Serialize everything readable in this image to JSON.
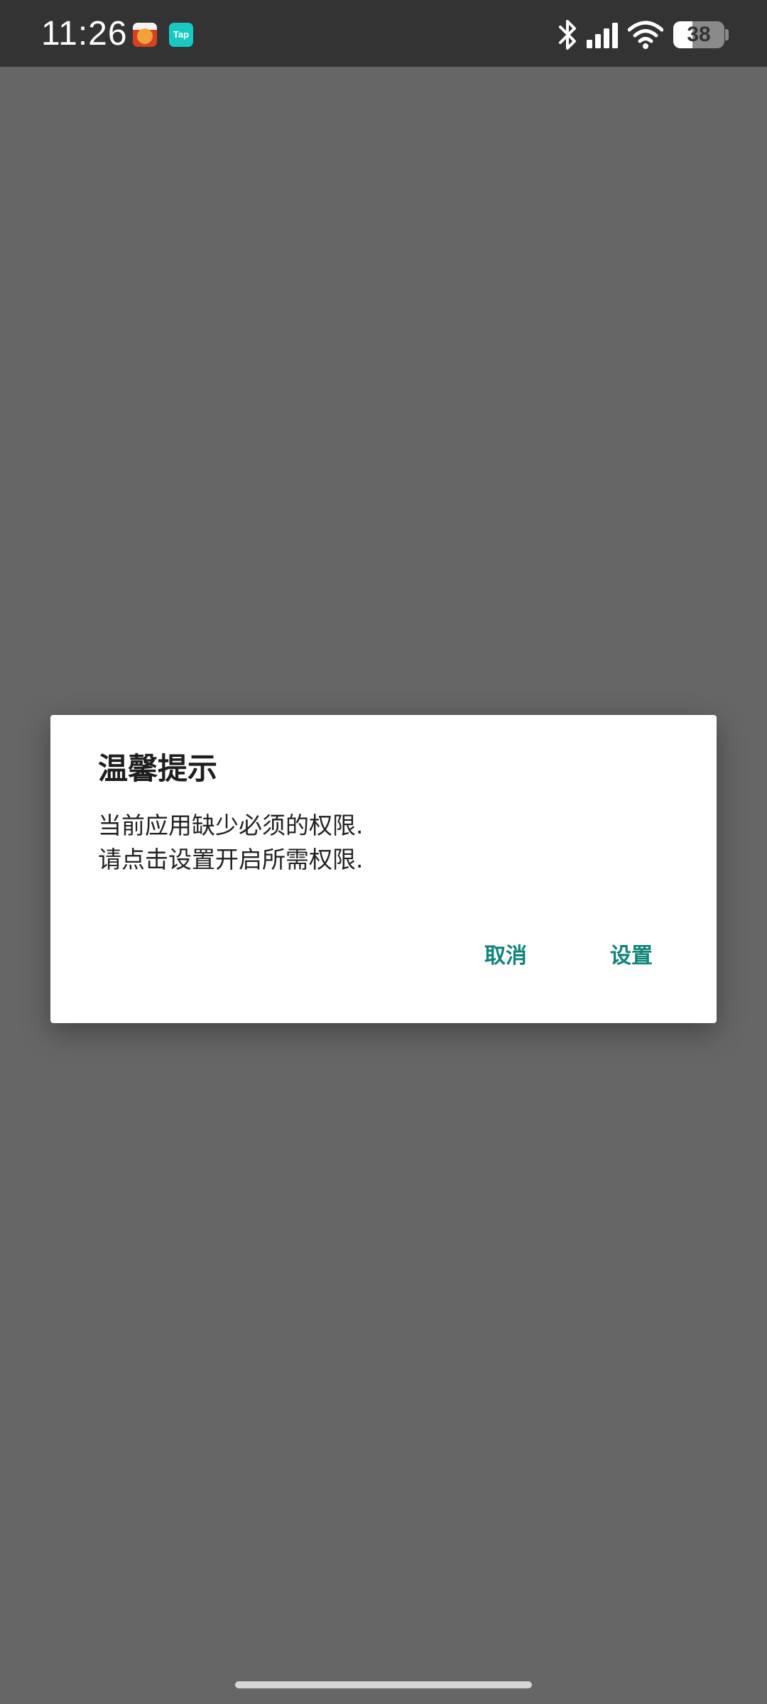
{
  "status_bar": {
    "time": "11:26",
    "notification_icons": [
      "app-icon",
      "taptap-icon"
    ],
    "tap_icon_text": "Tap",
    "battery_level": "38",
    "battery_fraction": 0.38,
    "icons": [
      "bluetooth-icon",
      "signal-icon",
      "wifi-icon",
      "battery-icon"
    ]
  },
  "background": {
    "scrim_color": "#666666"
  },
  "dialog": {
    "title": "温馨提示",
    "message_line1": "当前应用缺少必须的权限.",
    "message_line2": "请点击设置开启所需权限.",
    "cancel_label": "取消",
    "settings_label": "设置",
    "accent_color": "#0f8479"
  }
}
